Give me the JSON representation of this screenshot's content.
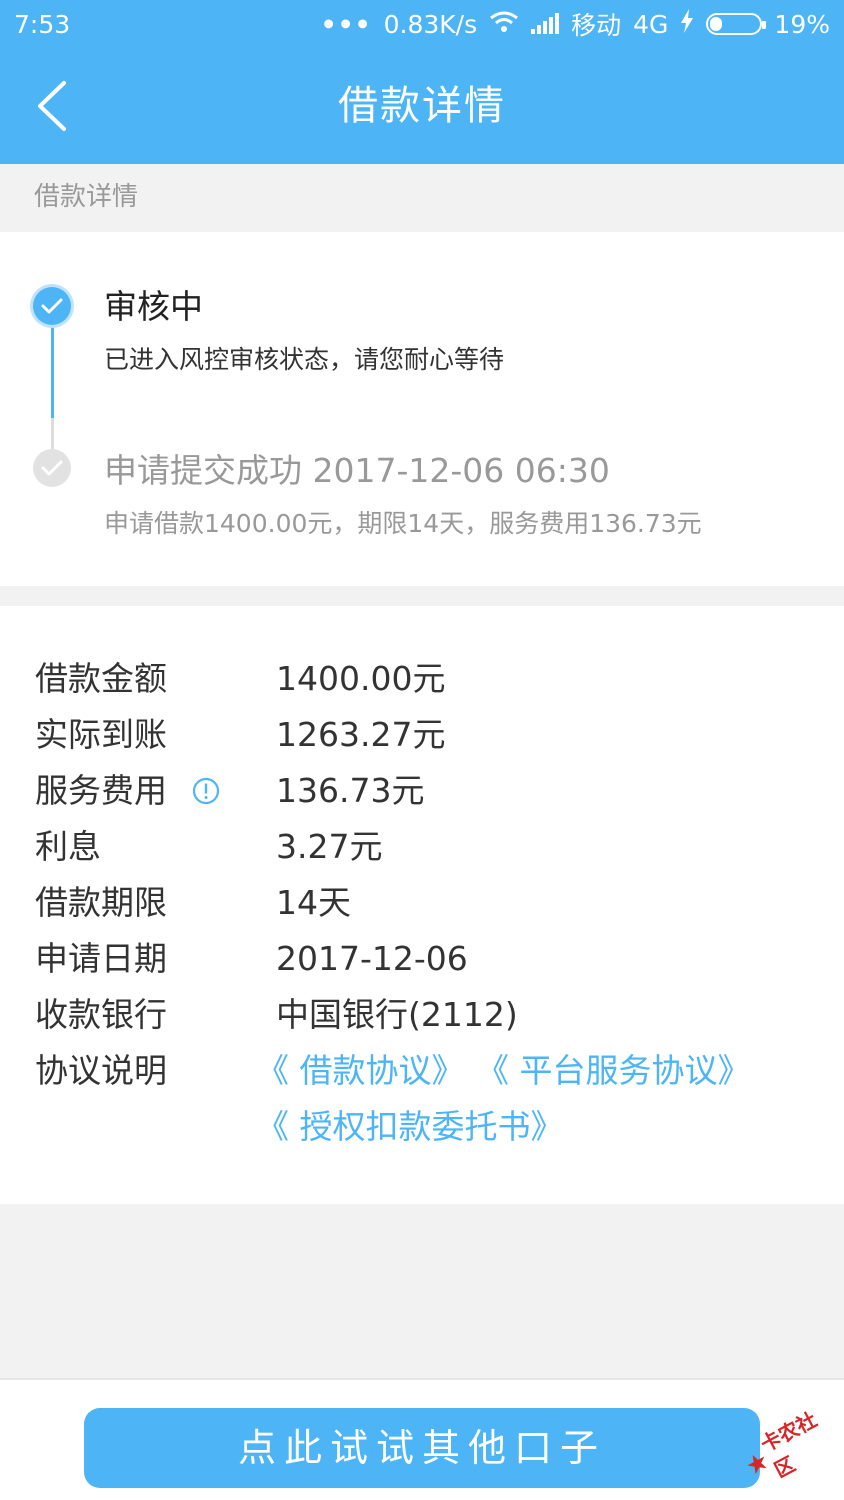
{
  "status_bar": {
    "time": "7:53",
    "network_speed": "0.83K/s",
    "carrier": "移动",
    "network_type": "4G",
    "battery": "19%"
  },
  "nav": {
    "title": "借款详情"
  },
  "section_header": "借款详情",
  "timeline": [
    {
      "title": "审核中",
      "desc": "已进入风控审核状态，请您耐心等待",
      "state": "active"
    },
    {
      "title": "申请提交成功 2017-12-06 06:30",
      "desc": "申请借款1400.00元，期限14天，服务费用136.73元",
      "state": "done"
    }
  ],
  "details": [
    {
      "label": "借款金额",
      "value": "1400.00元"
    },
    {
      "label": "实际到账",
      "value": "1263.27元"
    },
    {
      "label": "服务费用",
      "value": "136.73元"
    },
    {
      "label": "利息",
      "value": "3.27元"
    },
    {
      "label": "借款期限",
      "value": "14天"
    },
    {
      "label": "申请日期",
      "value": "2017-12-06"
    },
    {
      "label": "收款银行",
      "value": "中国银行(2112)"
    }
  ],
  "agreements": {
    "label": "协议说明",
    "links": [
      "《 借款协议》",
      "《 平台服务协议》",
      "《 授权扣款委托书》"
    ]
  },
  "cta": "点此试试其他口子",
  "watermark": "卡农社区",
  "colors": {
    "primary": "#4db5f5",
    "background": "#f2f2f2",
    "watermark": "#d6262a"
  }
}
